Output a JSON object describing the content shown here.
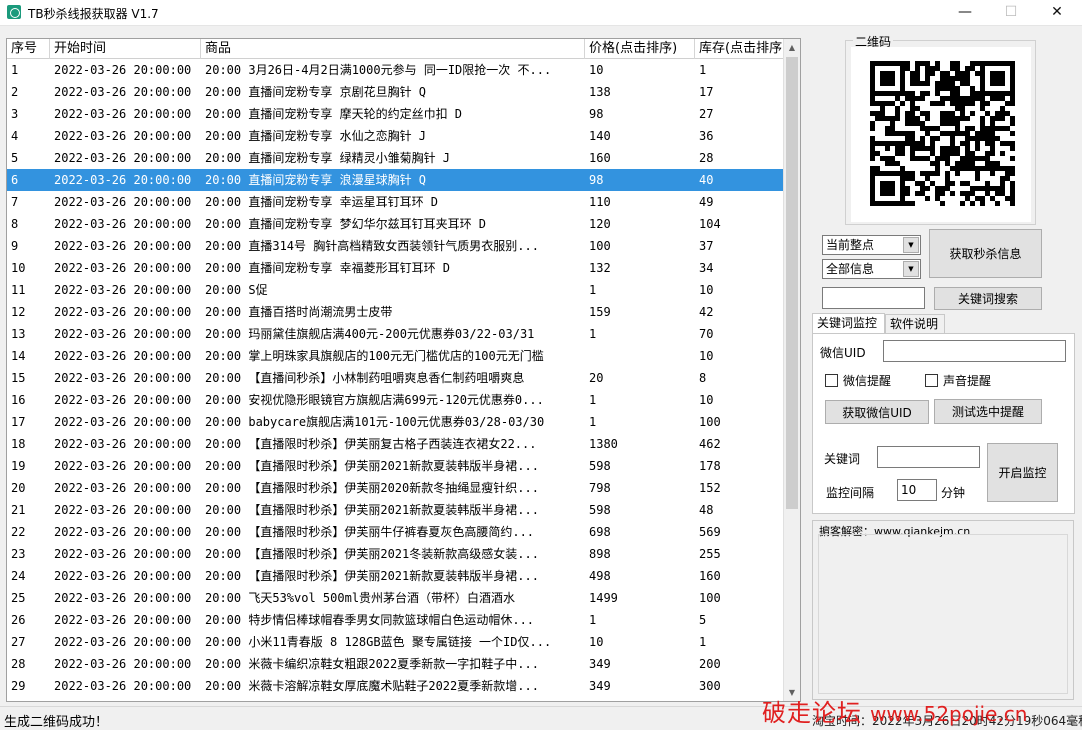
{
  "window": {
    "title": "TB秒杀线报获取器 V1.7",
    "minimize_glyph": "—",
    "maximize_glyph": "☐",
    "close_glyph": "✕"
  },
  "table": {
    "headers": [
      "序号",
      "开始时间",
      "商品",
      "价格(点击排序)",
      "库存(点击排序)"
    ],
    "selected_row": 6,
    "rows": [
      [
        "1",
        "2022-03-26 20:00:00",
        "20:00 3月26日-4月2日满1000元参与 同一ID限抢一次 不...",
        "10",
        "1"
      ],
      [
        "2",
        "2022-03-26 20:00:00",
        "20:00 直播间宠粉专享 京剧花旦胸针 Q",
        "138",
        "17"
      ],
      [
        "3",
        "2022-03-26 20:00:00",
        "20:00 直播间宠粉专享 摩天轮的约定丝巾扣 D",
        "98",
        "27"
      ],
      [
        "4",
        "2022-03-26 20:00:00",
        "20:00 直播间宠粉专享 水仙之恋胸针 J",
        "140",
        "36"
      ],
      [
        "5",
        "2022-03-26 20:00:00",
        "20:00 直播间宠粉专享 绿精灵小雏菊胸针 J",
        "160",
        "28"
      ],
      [
        "6",
        "2022-03-26 20:00:00",
        "20:00 直播间宠粉专享 浪漫星球胸针 Q",
        "98",
        "40"
      ],
      [
        "7",
        "2022-03-26 20:00:00",
        "20:00 直播间宠粉专享 幸运星耳钉耳环 D",
        "110",
        "49"
      ],
      [
        "8",
        "2022-03-26 20:00:00",
        "20:00 直播间宠粉专享 梦幻华尔兹耳钉耳夹耳环 D",
        "120",
        "104"
      ],
      [
        "9",
        "2022-03-26 20:00:00",
        "20:00 直播314号 胸针高档精致女西装领针气质男衣服别...",
        "100",
        "37"
      ],
      [
        "10",
        "2022-03-26 20:00:00",
        "20:00 直播间宠粉专享 幸福菱形耳钉耳环 D",
        "132",
        "34"
      ],
      [
        "11",
        "2022-03-26 20:00:00",
        "20:00 S促",
        "1",
        "10"
      ],
      [
        "12",
        "2022-03-26 20:00:00",
        "20:00 直播百搭时尚潮流男士皮带",
        "159",
        "42"
      ],
      [
        "13",
        "2022-03-26 20:00:00",
        "20:00 玛丽黛佳旗舰店满400元-200元优惠券03/22-03/31",
        "1",
        "70"
      ],
      [
        "14",
        "2022-03-26 20:00:00",
        "20:00 掌上明珠家具旗舰店的100元无门槛优店的100元无门槛",
        "",
        "10"
      ],
      [
        "15",
        "2022-03-26 20:00:00",
        "20:00 【直播间秒杀】小林制药咀嚼爽息香仁制药咀嚼爽息",
        "20",
        "8"
      ],
      [
        "16",
        "2022-03-26 20:00:00",
        "20:00 安视优隐形眼镜官方旗舰店满699元-120元优惠券0...",
        "1",
        "10"
      ],
      [
        "17",
        "2022-03-26 20:00:00",
        "20:00 babycare旗舰店满101元-100元优惠券03/28-03/30",
        "1",
        "100"
      ],
      [
        "18",
        "2022-03-26 20:00:00",
        "20:00 【直播限时秒杀】伊芙丽复古格子西装连衣裙女22...",
        "1380",
        "462"
      ],
      [
        "19",
        "2022-03-26 20:00:00",
        "20:00 【直播限时秒杀】伊芙丽2021新款夏装韩版半身裙...",
        "598",
        "178"
      ],
      [
        "20",
        "2022-03-26 20:00:00",
        "20:00 【直播限时秒杀】伊芙丽2020新款冬抽绳显瘦针织...",
        "798",
        "152"
      ],
      [
        "21",
        "2022-03-26 20:00:00",
        "20:00 【直播限时秒杀】伊芙丽2021新款夏装韩版半身裙...",
        "598",
        "48"
      ],
      [
        "22",
        "2022-03-26 20:00:00",
        "20:00 【直播限时秒杀】伊芙丽牛仔裤春夏灰色高腰简约...",
        "698",
        "569"
      ],
      [
        "23",
        "2022-03-26 20:00:00",
        "20:00 【直播限时秒杀】伊芙丽2021冬装新款高级感女装...",
        "898",
        "255"
      ],
      [
        "24",
        "2022-03-26 20:00:00",
        "20:00 【直播限时秒杀】伊芙丽2021新款夏装韩版半身裙...",
        "498",
        "160"
      ],
      [
        "25",
        "2022-03-26 20:00:00",
        "20:00 飞天53%vol 500ml贵州茅台酒（带杯）白酒酒水",
        "1499",
        "100"
      ],
      [
        "26",
        "2022-03-26 20:00:00",
        "20:00 特步情侣棒球帽春季男女同款篮球帽白色运动帽休...",
        "1",
        "5"
      ],
      [
        "27",
        "2022-03-26 20:00:00",
        "20:00 小米11青春版 8 128GB蓝色 聚专属链接 一个ID仅...",
        "10",
        "1"
      ],
      [
        "28",
        "2022-03-26 20:00:00",
        "20:00 米薇卡编织凉鞋女粗跟2022夏季新款一字扣鞋子中...",
        "349",
        "200"
      ],
      [
        "29",
        "2022-03-26 20:00:00",
        "20:00 米薇卡溶解凉鞋女厚底魔术贴鞋子2022夏季新款增...",
        "349",
        "300"
      ]
    ]
  },
  "qr": {
    "legend": "二维码"
  },
  "controls": {
    "combo_time": "当前整点",
    "combo_info": "全部信息",
    "fetch_button": "获取秒杀信息",
    "keyword_search_button": "关键词搜索",
    "search_value": ""
  },
  "tabs": [
    "关键词监控",
    "软件说明"
  ],
  "monitor": {
    "wechat_uid_label": "微信UID",
    "wechat_uid_value": "",
    "wechat_remind": "微信提醒",
    "sound_remind": "声音提醒",
    "get_uid_button": "获取微信UID",
    "test_button": "测试选中提醒",
    "keyword_label": "关键词",
    "keyword_value": "",
    "interval_label": "监控间隔",
    "interval_value": "10",
    "interval_unit": "分钟",
    "start_button": "开启监控"
  },
  "decrypt": {
    "label": "掮客解密：www.qiankejm.cn"
  },
  "status": {
    "left": "生成二维码成功！",
    "right": "淘宝时间：2022年3月26日20时42分19秒064毫秒"
  },
  "watermark": {
    "text": "破走论坛",
    "url": "www.52pojie.cn"
  },
  "colors": {
    "selected_row": "#3393df",
    "watermark": "#e02020"
  }
}
